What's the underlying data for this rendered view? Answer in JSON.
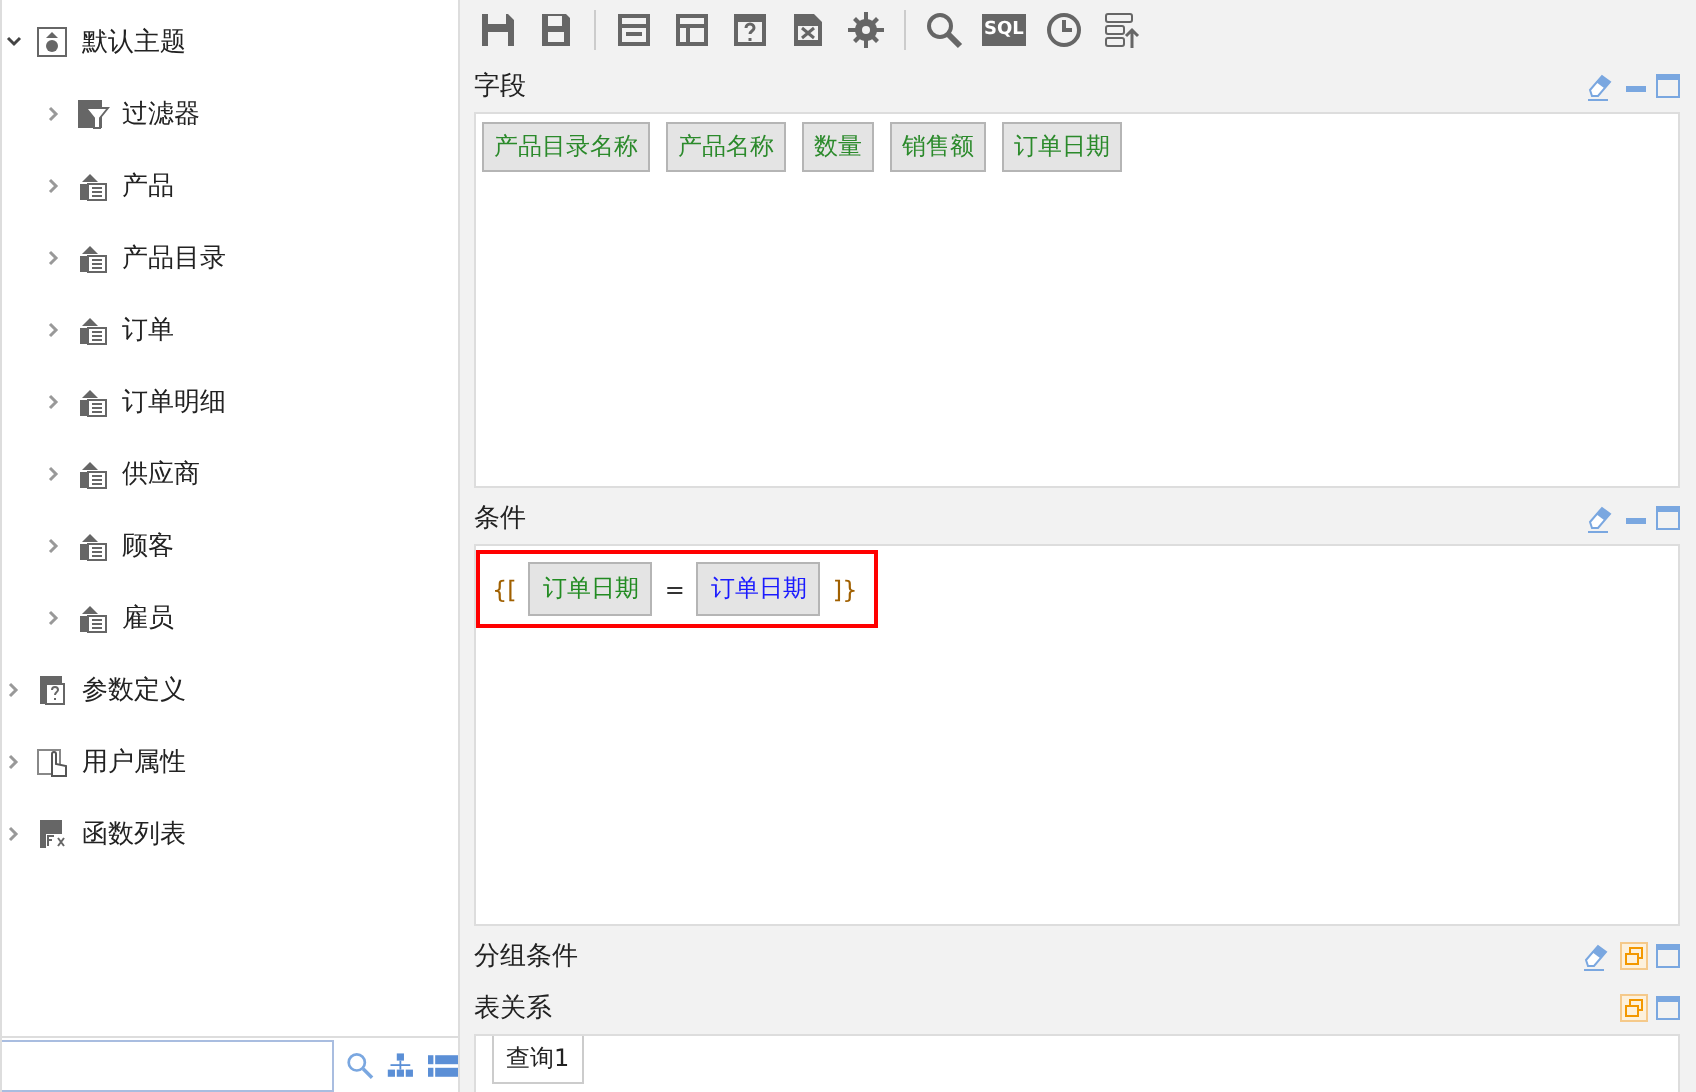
{
  "tree": [
    {
      "label": "默认主题",
      "kind": "theme",
      "expanded": true,
      "children": [
        {
          "label": "过滤器",
          "kind": "filter",
          "expanded": false
        },
        {
          "label": "产品",
          "kind": "table",
          "expanded": false
        },
        {
          "label": "产品目录",
          "kind": "table",
          "expanded": false
        },
        {
          "label": "订单",
          "kind": "table",
          "expanded": false
        },
        {
          "label": "订单明细",
          "kind": "table",
          "expanded": false
        },
        {
          "label": "供应商",
          "kind": "table",
          "expanded": false
        },
        {
          "label": "顾客",
          "kind": "table",
          "expanded": false
        },
        {
          "label": "雇员",
          "kind": "table",
          "expanded": false
        }
      ]
    },
    {
      "label": "参数定义",
      "kind": "param",
      "expanded": false
    },
    {
      "label": "用户属性",
      "kind": "user",
      "expanded": false
    },
    {
      "label": "函数列表",
      "kind": "function",
      "expanded": false
    }
  ],
  "toolbar": {
    "sql_label": "SQL"
  },
  "sections": [
    {
      "kind": "fields",
      "title": "字段",
      "collapsed": false,
      "clearable": true,
      "chips": [
        "产品目录名称",
        "产品名称",
        "数量",
        "销售额",
        "订单日期"
      ]
    },
    {
      "kind": "conditions",
      "title": "条件",
      "collapsed": false,
      "clearable": true,
      "highlighted": true,
      "tokens": [
        {
          "kind": "bracket",
          "text": "{["
        },
        {
          "kind": "field",
          "text": "订单日期",
          "color": "#228b22"
        },
        {
          "kind": "operator",
          "text": "="
        },
        {
          "kind": "field",
          "text": "订单日期",
          "color": "#1a1aff"
        },
        {
          "kind": "bracket",
          "text": "]}"
        }
      ]
    },
    {
      "kind": "grouping",
      "title": "分组条件",
      "collapsed": true,
      "clearable": true
    },
    {
      "kind": "relations",
      "title": "表关系",
      "collapsed": true,
      "clearable": false,
      "tabs": [
        {
          "label": "查询1",
          "selected": true
        }
      ]
    }
  ]
}
